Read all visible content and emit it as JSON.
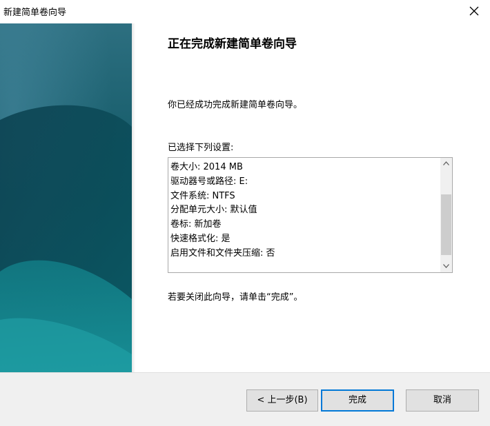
{
  "window": {
    "title": "新建简单卷向导",
    "close_icon": "close-icon"
  },
  "colors": {
    "banner_dark": "#0b4f5e",
    "banner_light": "#1f8e98",
    "accent": "#0078d7",
    "footer_bg": "#f0f0f0"
  },
  "content": {
    "heading": "正在完成新建简单卷向导",
    "completed_text": "你已经成功完成新建简单卷向导。",
    "settings_label": "已选择下列设置:",
    "settings": [
      "卷大小: 2014 MB",
      "驱动器号或路径: E:",
      "文件系统: NTFS",
      "分配单元大小: 默认值",
      "卷标: 新加卷",
      "快速格式化: 是",
      "启用文件和文件夹压缩: 否"
    ],
    "close_hint": "若要关闭此向导，请单击“完成”。"
  },
  "footer": {
    "back_label": "< 上一步(B)",
    "finish_label": "完成",
    "cancel_label": "取消"
  }
}
